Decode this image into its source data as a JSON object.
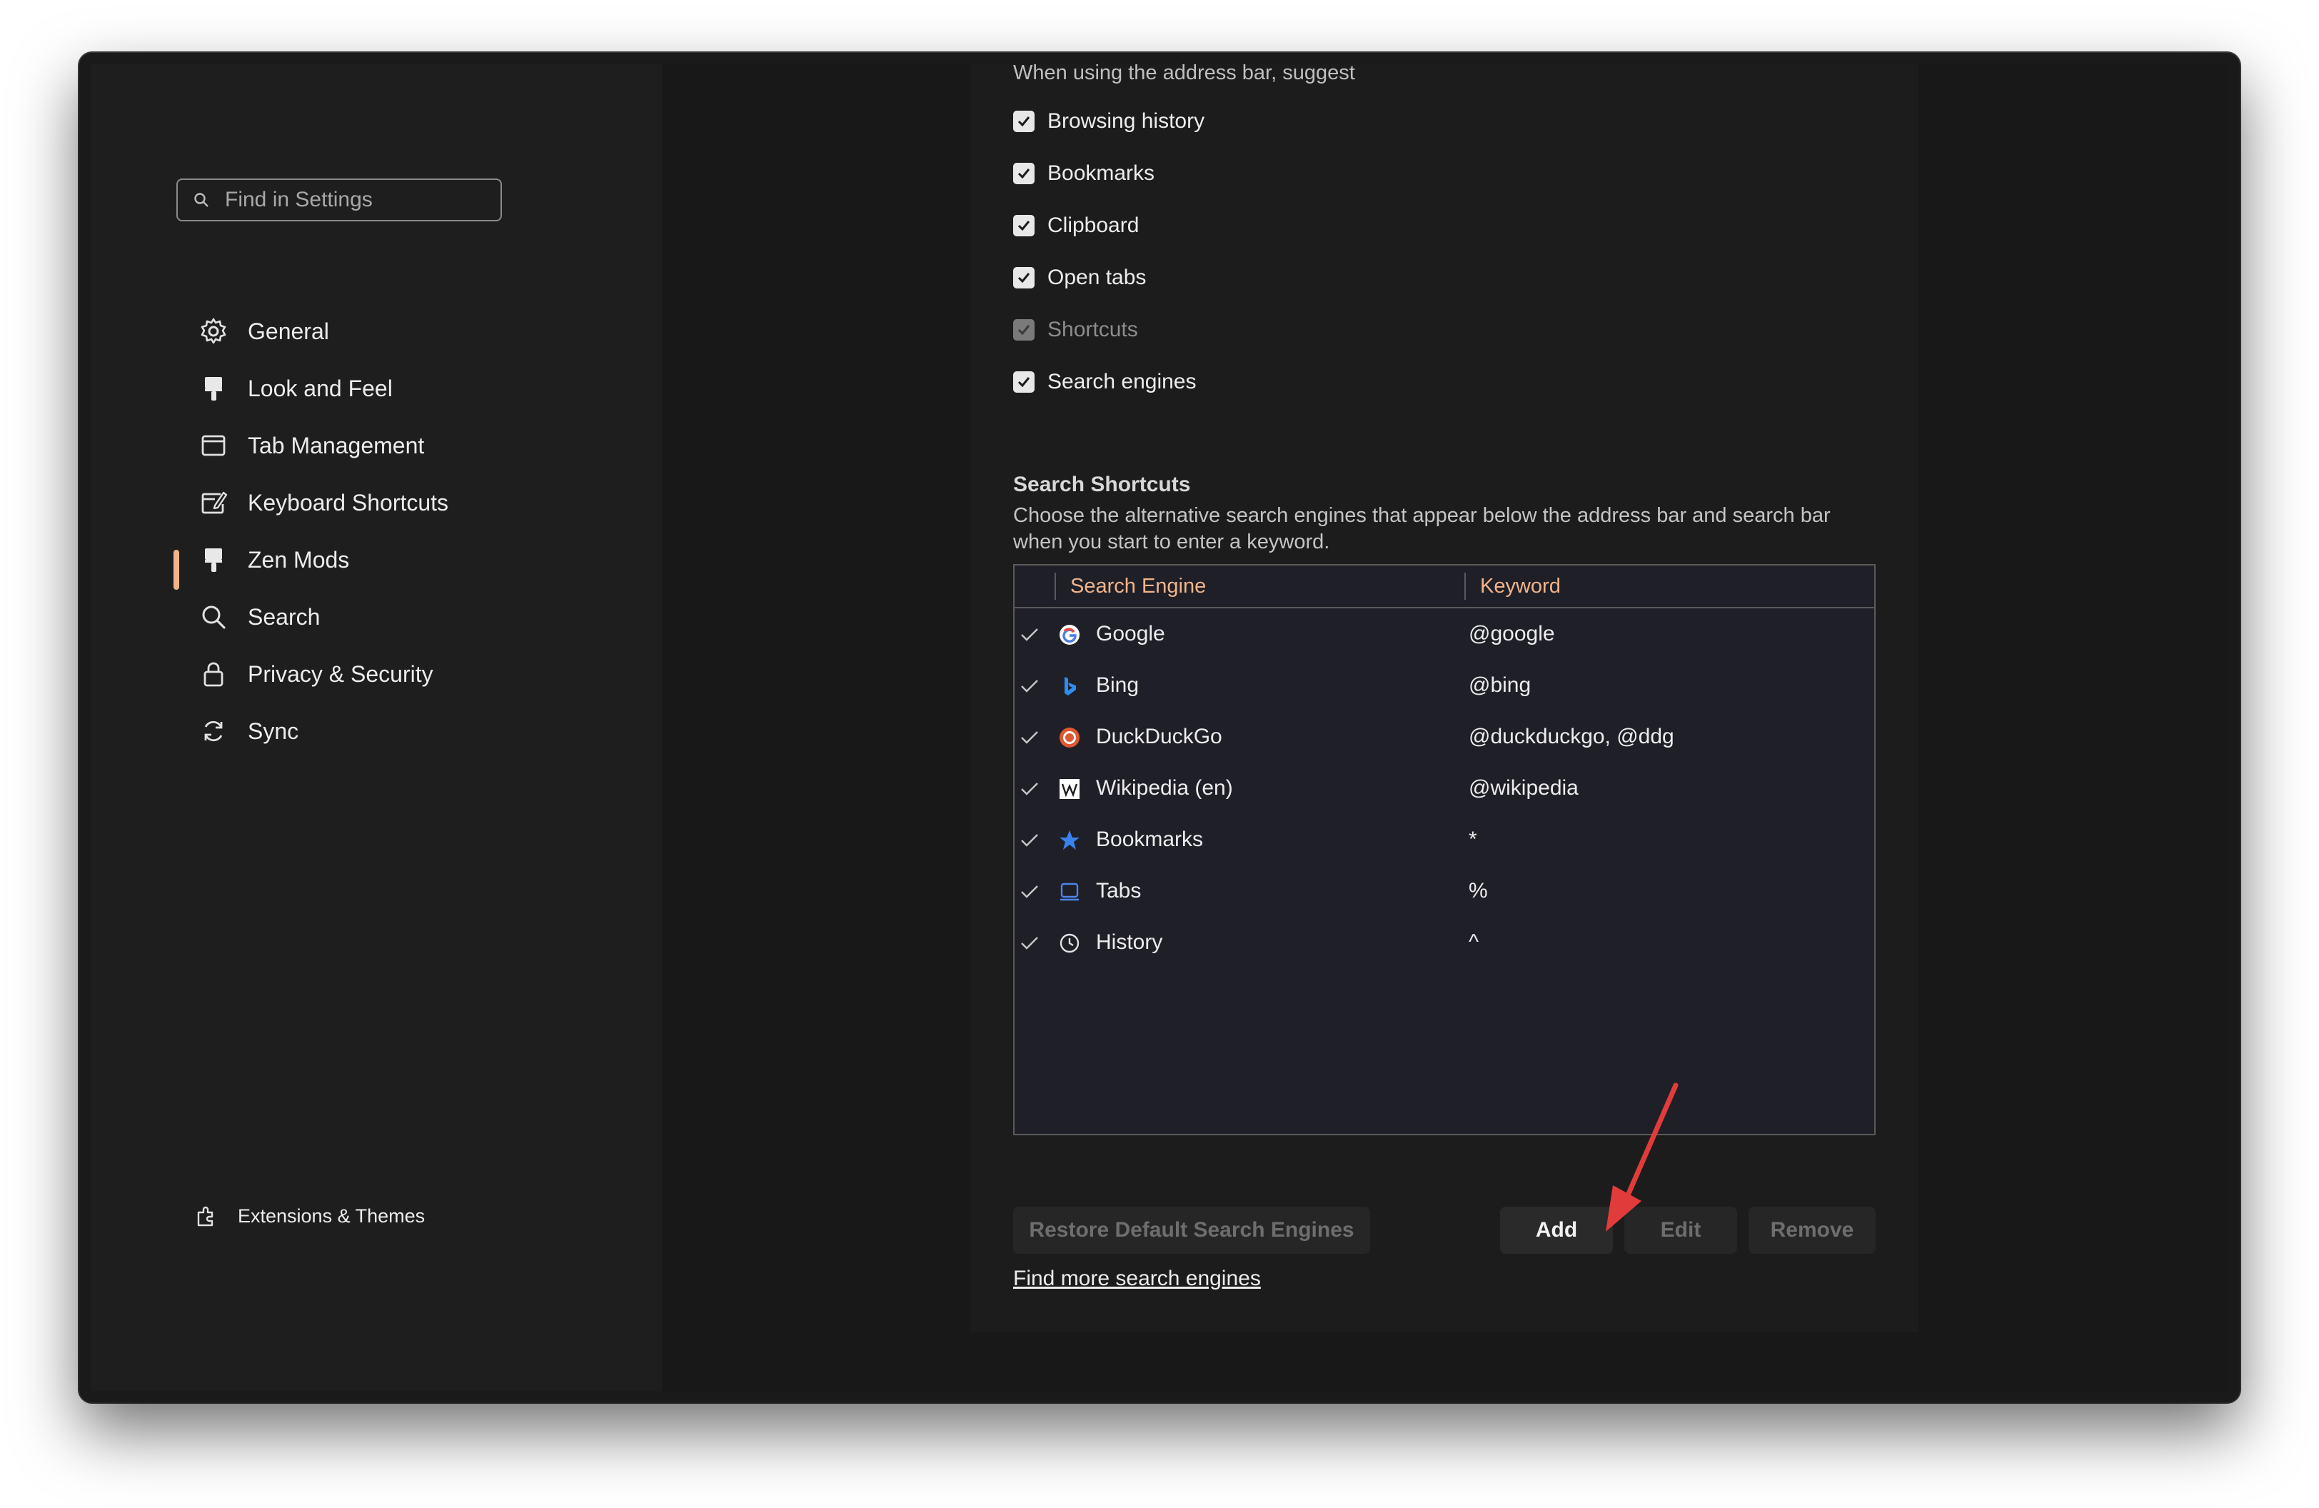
{
  "sidebar": {
    "search_placeholder": "Find in Settings",
    "items": [
      {
        "label": "General",
        "icon": "gear-icon"
      },
      {
        "label": "Look and Feel",
        "icon": "paintbrush-icon"
      },
      {
        "label": "Tab Management",
        "icon": "window-icon"
      },
      {
        "label": "Keyboard Shortcuts",
        "icon": "keyboard-edit-icon"
      },
      {
        "label": "Zen Mods",
        "icon": "paintbrush-icon"
      },
      {
        "label": "Search",
        "icon": "search-icon",
        "active": true
      },
      {
        "label": "Privacy & Security",
        "icon": "lock-icon"
      },
      {
        "label": "Sync",
        "icon": "sync-icon"
      }
    ],
    "footer_label": "Extensions & Themes",
    "accent_color": "#f0b48c"
  },
  "address_bar": {
    "heading": "When using the address bar, suggest",
    "options": [
      {
        "label": "Browsing history",
        "checked": true,
        "disabled": false
      },
      {
        "label": "Bookmarks",
        "checked": true,
        "disabled": false
      },
      {
        "label": "Clipboard",
        "checked": true,
        "disabled": false
      },
      {
        "label": "Open tabs",
        "checked": true,
        "disabled": false
      },
      {
        "label": "Shortcuts",
        "checked": true,
        "disabled": true
      },
      {
        "label": "Search engines",
        "checked": true,
        "disabled": false
      }
    ]
  },
  "search_shortcuts": {
    "title": "Search Shortcuts",
    "description": "Choose the alternative search engines that appear below the address bar and search bar when you start to enter a keyword.",
    "columns": {
      "engine": "Search Engine",
      "keyword": "Keyword"
    },
    "engines": [
      {
        "name": "Google",
        "keyword": "@google",
        "icon": "google-icon",
        "enabled": true
      },
      {
        "name": "Bing",
        "keyword": "@bing",
        "icon": "bing-icon",
        "enabled": true
      },
      {
        "name": "DuckDuckGo",
        "keyword": "@duckduckgo, @ddg",
        "icon": "duckduckgo-icon",
        "enabled": true
      },
      {
        "name": "Wikipedia (en)",
        "keyword": "@wikipedia",
        "icon": "wikipedia-icon",
        "enabled": true
      },
      {
        "name": "Bookmarks",
        "keyword": "*",
        "icon": "star-icon",
        "enabled": true
      },
      {
        "name": "Tabs",
        "keyword": "%",
        "icon": "tab-icon",
        "enabled": true
      },
      {
        "name": "History",
        "keyword": "^",
        "icon": "clock-icon",
        "enabled": true
      }
    ],
    "buttons": {
      "restore": "Restore Default Search Engines",
      "add": "Add",
      "edit": "Edit",
      "remove": "Remove"
    },
    "find_more_link": "Find more search engines"
  }
}
